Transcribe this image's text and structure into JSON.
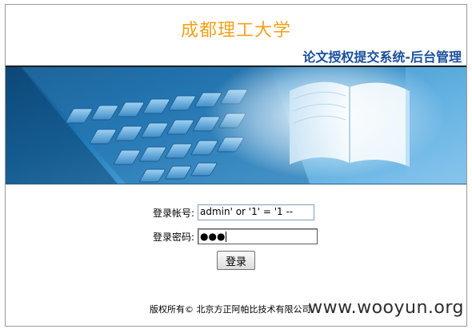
{
  "header": {
    "university_name": "成都理工大学",
    "system_title": "论文授权提交系统-后台管理"
  },
  "login": {
    "username_label": "登录帐号:",
    "username_value": "admin' or '1' = '1 --",
    "password_label": "登录密码:",
    "password_mask": "●●●",
    "submit_label": "登录"
  },
  "footer": {
    "copyright": "版权所有© 北京方正阿帕比技术有限公司"
  },
  "watermark": "www.wooyun.org",
  "colors": {
    "university_name": "#f2a21b",
    "system_title": "#1a4f9c",
    "banner": "#1f79b8"
  },
  "banner_image": "keyboard-and-open-book-icon"
}
